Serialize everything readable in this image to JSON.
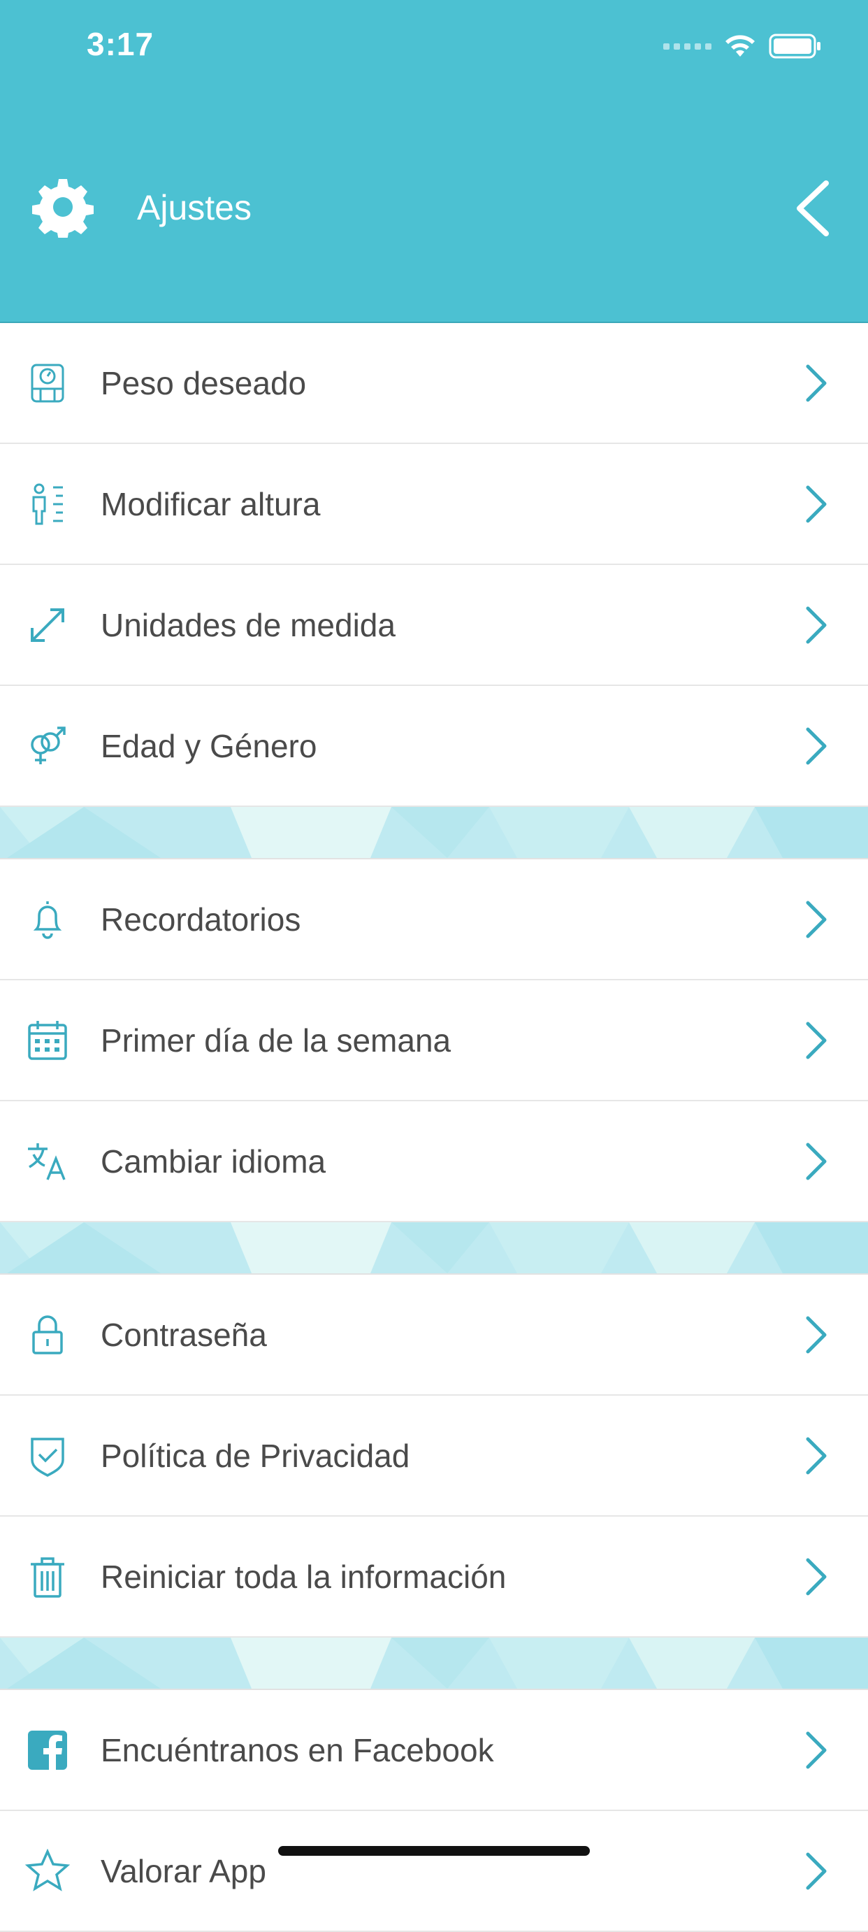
{
  "status_bar": {
    "time": "3:17"
  },
  "header": {
    "title": "Ajustes"
  },
  "sections": [
    {
      "items": [
        {
          "label": "Peso deseado",
          "icon": "scale-icon"
        },
        {
          "label": "Modificar altura",
          "icon": "height-icon"
        },
        {
          "label": "Unidades de medida",
          "icon": "resize-arrow-icon"
        },
        {
          "label": "Edad y Género",
          "icon": "gender-icon"
        }
      ]
    },
    {
      "items": [
        {
          "label": "Recordatorios",
          "icon": "bell-icon"
        },
        {
          "label": "Primer día de la semana",
          "icon": "calendar-icon"
        },
        {
          "label": "Cambiar idioma",
          "icon": "translate-icon"
        }
      ]
    },
    {
      "items": [
        {
          "label": "Contraseña",
          "icon": "lock-icon"
        },
        {
          "label": "Política de Privacidad",
          "icon": "shield-check-icon"
        },
        {
          "label": "Reiniciar toda la información",
          "icon": "trash-icon"
        }
      ]
    },
    {
      "items": [
        {
          "label": "Encuéntranos en Facebook",
          "icon": "facebook-icon"
        },
        {
          "label": "Valorar App",
          "icon": "star-icon"
        }
      ]
    }
  ],
  "colors": {
    "accent": "#4cc1d2",
    "icon": "#3aaabf",
    "chevron": "#3aaabf",
    "text": "#4a4a4a"
  }
}
